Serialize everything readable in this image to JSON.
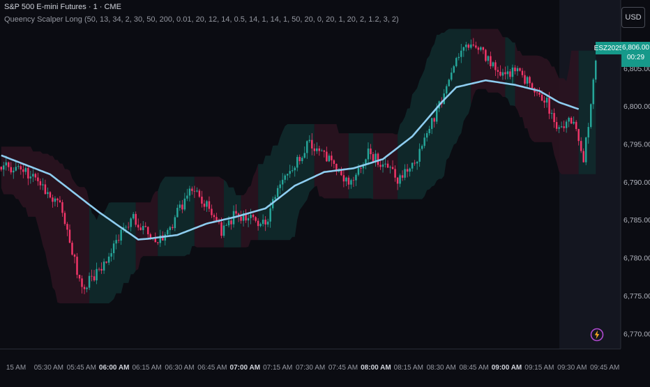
{
  "header": {
    "title": "S&P 500 E-mini Futures · 1 · CME",
    "indicator": "Queency Scalper Long (50, 13, 34, 2, 30, 50, 200, 0.01, 20, 12, 14, 0.5, 14, 1, 14, 1, 50, 20, 0, 20, 1, 20, 2, 1.2, 3, 2)"
  },
  "toolbar": {
    "currency": "USD"
  },
  "last_price": {
    "symbol": "ESZ2025",
    "price": "6,806.00",
    "countdown": "00:29"
  },
  "icons": {
    "bolt": "lightning-icon"
  },
  "colors": {
    "background": "#0b0c12",
    "up": "#26a69a",
    "down": "#f23669",
    "ema": "#8ecdf0",
    "badge": "#16998a",
    "band_up": "#0f2a2c",
    "band_down": "#2a1320"
  },
  "chart_data": {
    "type": "candlestick",
    "title": "S&P 500 E-mini Futures · 1 · CME",
    "ylim": [
      6768,
      6814
    ],
    "yticks": [
      "6,770.00",
      "6,775.00",
      "6,780.00",
      "6,785.00",
      "6,790.00",
      "6,795.00",
      "6,800.00",
      "6,805.00"
    ],
    "ytick_values": [
      6770,
      6775,
      6780,
      6785,
      6790,
      6795,
      6800,
      6805
    ],
    "xticks": [
      "15 AM",
      "05:30 AM",
      "05:45 AM",
      "06:00 AM",
      "06:15 AM",
      "06:30 AM",
      "06:45 AM",
      "07:00 AM",
      "07:15 AM",
      "07:30 AM",
      "07:45 AM",
      "08:00 AM",
      "08:15 AM",
      "08:30 AM",
      "08:45 AM",
      "09:00 AM",
      "09:15 AM",
      "09:30 AM",
      "09:45 AM"
    ],
    "xtick_bold": [
      false,
      false,
      false,
      true,
      false,
      false,
      false,
      true,
      false,
      false,
      false,
      true,
      false,
      false,
      false,
      true,
      false,
      false,
      false
    ],
    "price_path": [
      [
        0,
        6792
      ],
      [
        10,
        6791.5
      ],
      [
        18,
        6788.5
      ],
      [
        24,
        6787
      ],
      [
        28,
        6782
      ],
      [
        33,
        6775.5
      ],
      [
        36,
        6777
      ],
      [
        42,
        6779
      ],
      [
        48,
        6783
      ],
      [
        54,
        6785.5
      ],
      [
        60,
        6783
      ],
      [
        66,
        6782
      ],
      [
        72,
        6786
      ],
      [
        78,
        6789
      ],
      [
        84,
        6787
      ],
      [
        90,
        6783.5
      ],
      [
        96,
        6786
      ],
      [
        102,
        6785
      ],
      [
        108,
        6784.5
      ],
      [
        114,
        6790
      ],
      [
        120,
        6792.5
      ],
      [
        126,
        6795
      ],
      [
        132,
        6794
      ],
      [
        138,
        6791
      ],
      [
        144,
        6790
      ],
      [
        150,
        6794
      ],
      [
        156,
        6792
      ],
      [
        162,
        6790.5
      ],
      [
        168,
        6792
      ],
      [
        174,
        6796
      ],
      [
        180,
        6801
      ],
      [
        186,
        6807
      ],
      [
        192,
        6808
      ],
      [
        198,
        6806.5
      ],
      [
        204,
        6803.5
      ],
      [
        210,
        6805
      ],
      [
        216,
        6803
      ],
      [
        222,
        6801
      ],
      [
        228,
        6797
      ],
      [
        234,
        6798
      ],
      [
        238,
        6792.5
      ],
      [
        243,
        6806
      ]
    ],
    "ema_path": [
      [
        0,
        6793.5
      ],
      [
        20,
        6791
      ],
      [
        40,
        6786
      ],
      [
        56,
        6782.4
      ],
      [
        60,
        6782.5
      ],
      [
        72,
        6783
      ],
      [
        84,
        6784.5
      ],
      [
        96,
        6785.4
      ],
      [
        108,
        6786.5
      ],
      [
        120,
        6789.5
      ],
      [
        132,
        6791.3
      ],
      [
        144,
        6791.8
      ],
      [
        156,
        6793
      ],
      [
        168,
        6796
      ],
      [
        180,
        6800.5
      ],
      [
        186,
        6802.5
      ],
      [
        198,
        6803.4
      ],
      [
        210,
        6802.8
      ],
      [
        220,
        6802
      ],
      [
        228,
        6800.5
      ],
      [
        236,
        6799.6
      ]
    ],
    "last_close": 6806.0
  }
}
